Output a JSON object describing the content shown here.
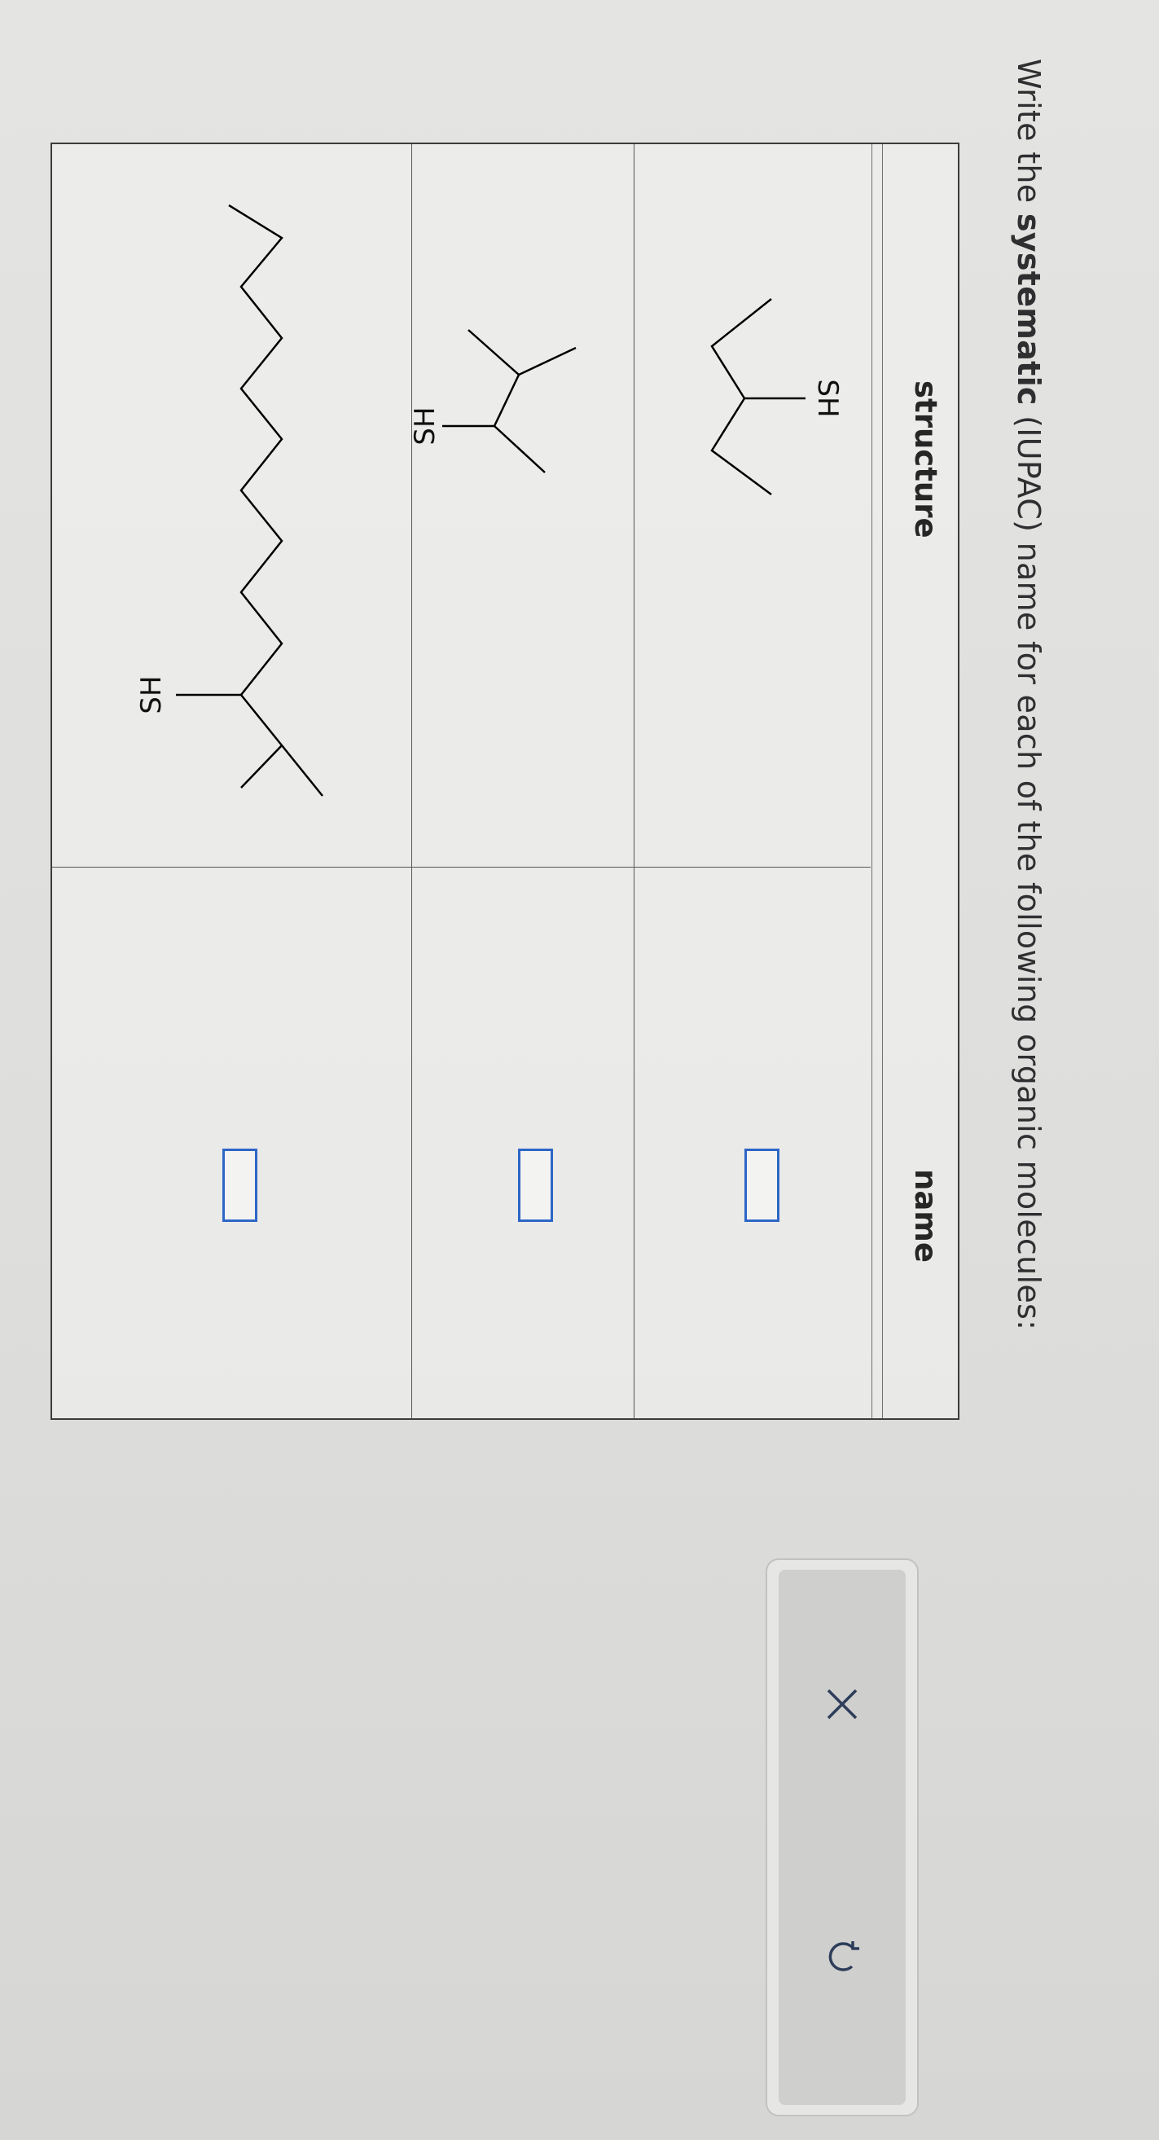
{
  "question": {
    "prefix": "Write the ",
    "keyword": "systematic",
    "suffix": " (IUPAC) name for each of the following organic molecules:"
  },
  "table": {
    "headers": {
      "structure": "structure",
      "name": "name"
    },
    "rows": [
      {
        "substituent_label": "SH",
        "name_value": ""
      },
      {
        "substituent_label": "SH",
        "name_value": ""
      },
      {
        "substituent_label": "SH",
        "name_value": ""
      }
    ]
  },
  "toolbar": {
    "clear_icon": "x-icon",
    "undo_icon": "undo-icon"
  },
  "colors": {
    "answer_box_border": "#2d66c7",
    "text": "#2f2f31"
  }
}
